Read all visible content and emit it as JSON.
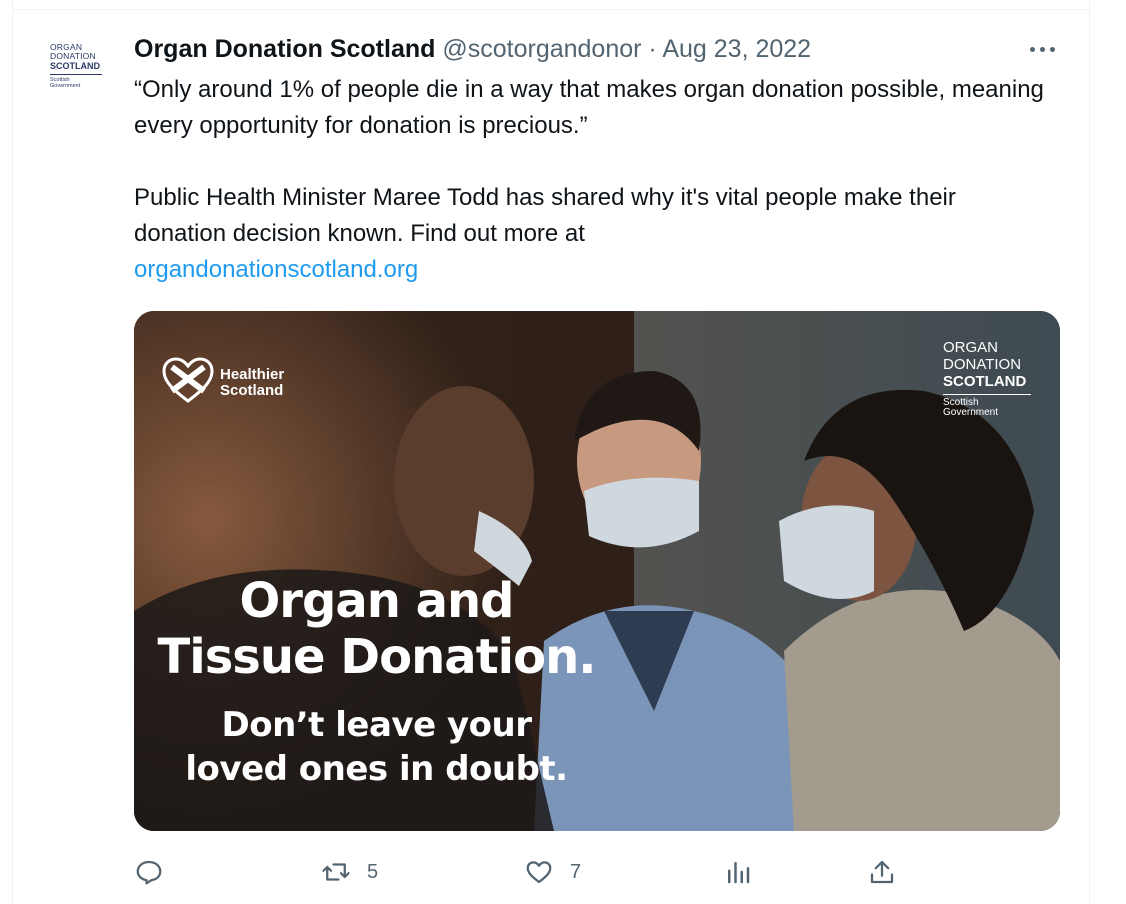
{
  "avatar": {
    "line1": "ORGAN",
    "line2": "DONATION",
    "line3": "SCOTLAND",
    "line4a": "Scottish",
    "line4b": "Government"
  },
  "header": {
    "name": "Organ Donation Scotland",
    "handle": "@scotorgandonor",
    "separator": "·",
    "date": "Aug 23, 2022"
  },
  "tweet": {
    "quote": "“Only around 1% of people die in a way that makes organ donation possible, meaning every opportunity for donation is precious.”",
    "body": "Public Health Minister Maree Todd has shared why it's vital people make their donation decision known. Find out more at",
    "link": "organdonationscotland.org"
  },
  "media": {
    "healthier_line1": "Healthier",
    "healthier_line2": "Scotland",
    "ods_line1": "ORGAN",
    "ods_line2": "DONATION",
    "ods_line3": "SCOTLAND",
    "ods_line4a": "Scottish",
    "ods_line4b": "Government",
    "headline_line1": "Organ and",
    "headline_line2": "Tissue Donation.",
    "sub_line1": "Don’t leave your",
    "sub_line2": "loved ones in doubt."
  },
  "actions": {
    "retweet_count": "5",
    "like_count": "7"
  },
  "colors": {
    "link": "#1d9bf0",
    "secondary": "#536471",
    "text": "#0f1419"
  }
}
